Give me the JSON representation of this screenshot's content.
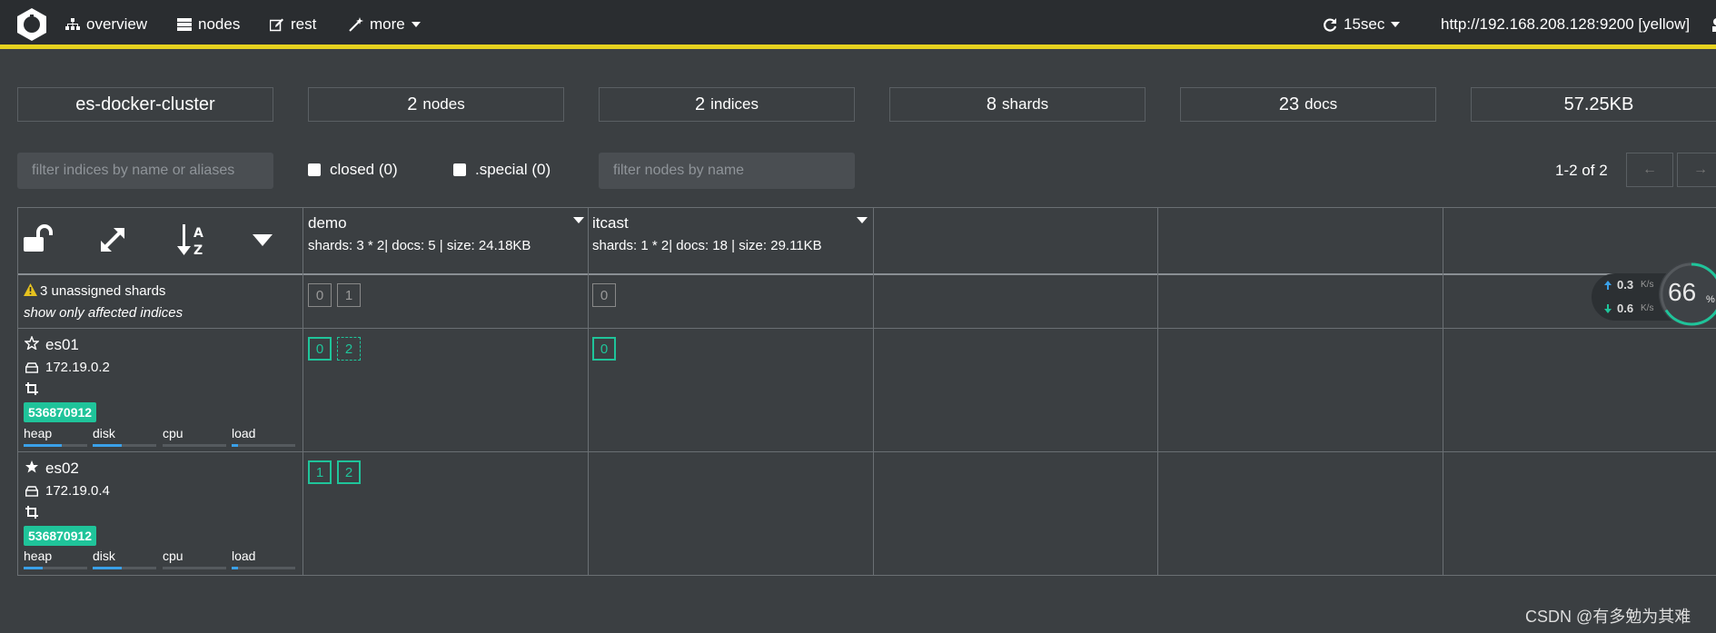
{
  "nav": {
    "overview": "overview",
    "nodes": "nodes",
    "rest": "rest",
    "more": "more",
    "refresh": "15sec",
    "cluster_url": "http://192.168.208.128:9200 [yellow]"
  },
  "stats": {
    "cluster_name": "es-docker-cluster",
    "nodes_num": "2",
    "nodes_label": "nodes",
    "indices_num": "2",
    "indices_label": "indices",
    "shards_num": "8",
    "shards_label": "shards",
    "docs_num": "23",
    "docs_label": "docs",
    "size": "57.25KB"
  },
  "filters": {
    "indices_placeholder": "filter indices by name or aliases",
    "closed_label": "closed (0)",
    "special_label": ".special (0)",
    "nodes_placeholder": "filter nodes by name",
    "pagination": "1-2 of 2",
    "prev": "←",
    "next": "→"
  },
  "indices": [
    {
      "name": "demo",
      "meta": "shards: 3 * 2| docs: 5 | size: 24.18KB"
    },
    {
      "name": "itcast",
      "meta": "shards: 1 * 2| docs: 18 | size: 29.11KB"
    }
  ],
  "unassigned": {
    "text": "3 unassigned shards",
    "link": "show only affected indices",
    "demo_shards": [
      "0",
      "1"
    ],
    "itcast_shards": [
      "0"
    ]
  },
  "nodes": [
    {
      "name": "es01",
      "ip": "172.19.0.2",
      "badge": "536870912",
      "master": false,
      "demo_shards": [
        "0",
        "2"
      ],
      "itcast_shards": [
        "0"
      ],
      "metrics": {
        "heap": 0.6,
        "disk": 0.45,
        "cpu": 0.0,
        "load": 0.1
      }
    },
    {
      "name": "es02",
      "ip": "172.19.0.4",
      "badge": "536870912",
      "master": true,
      "demo_shards": [
        "1",
        "2"
      ],
      "itcast_shards": [],
      "metrics": {
        "heap": 0.3,
        "disk": 0.45,
        "cpu": 0.0,
        "load": 0.1
      }
    }
  ],
  "metric_labels": {
    "heap": "heap",
    "disk": "disk",
    "cpu": "cpu",
    "load": "load"
  },
  "speed_widget": {
    "up": "0.3",
    "down": "0.6",
    "unit": "K/s",
    "percent": "66",
    "percent_sign": "%"
  },
  "watermark": "CSDN @有多勉为其难",
  "colors": {
    "accent_bar": "#e6d21f",
    "shard_green": "#1fc49a",
    "metric_blue": "#3aa0e8"
  }
}
